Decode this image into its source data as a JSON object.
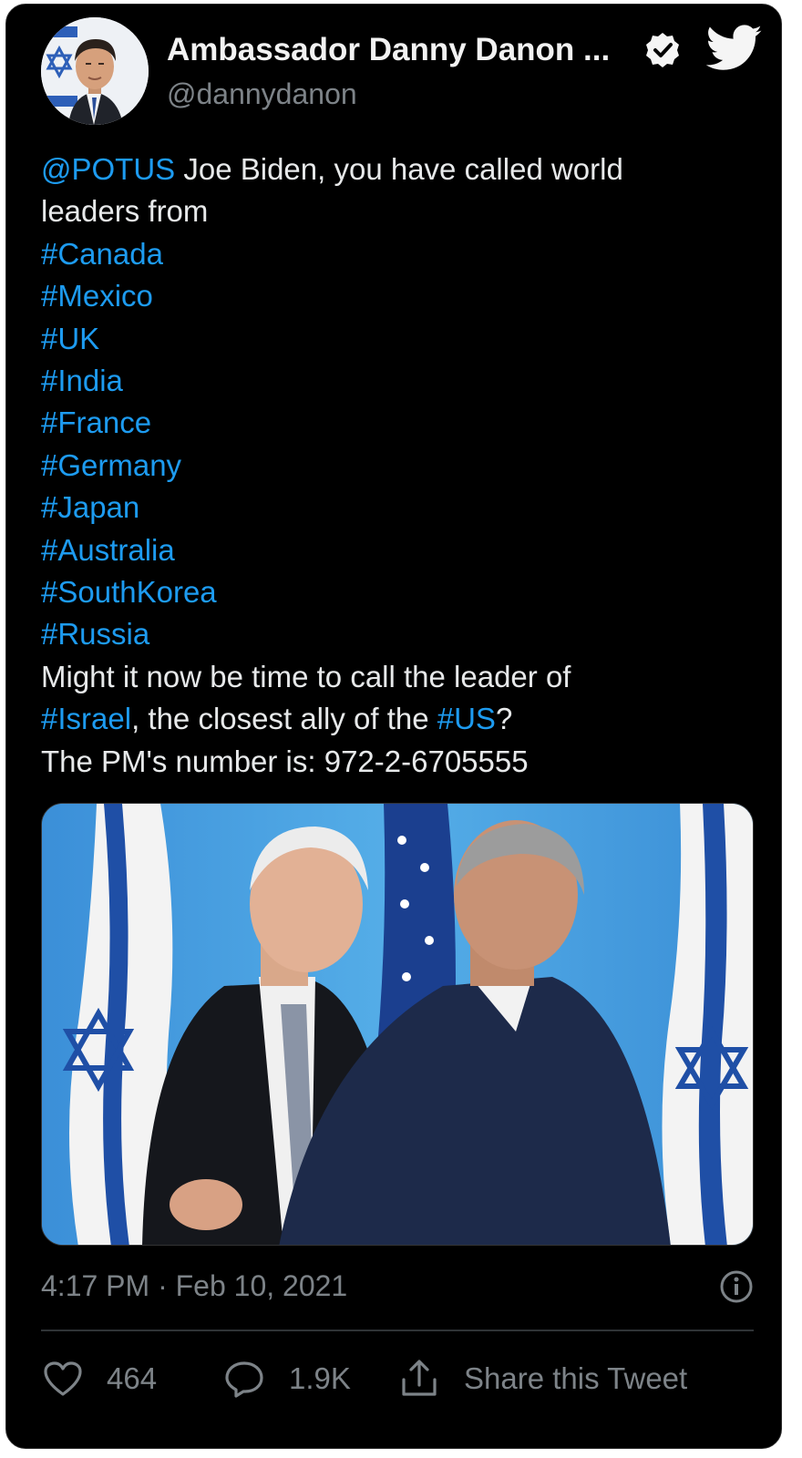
{
  "author": {
    "display_name": "Ambassador Danny Danon ...",
    "handle": "@dannydanon",
    "verified_icon": "verified-badge-icon",
    "platform_icon": "twitter-bird-icon"
  },
  "tweet": {
    "mention": "@POTUS",
    "intro_rest": " Joe Biden, you have called world",
    "intro_line2": "leaders from",
    "hashtags": [
      "#Canada",
      "#Mexico",
      "#UK",
      "#India",
      "#France",
      "#Germany",
      "#Japan",
      "#Australia",
      "#SouthKorea",
      "#Russia"
    ],
    "closing_line1": "Might it now be time to call the leader of",
    "israel_tag": "#Israel",
    "closing_mid": ", the closest ally of the ",
    "us_tag": "#US",
    "closing_end": "?",
    "phone_line": "The PM's number is: 972-2-6705555"
  },
  "meta": {
    "timestamp": "4:17 PM · Feb 10, 2021"
  },
  "actions": {
    "likes": "464",
    "replies": "1.9K",
    "share_label": "Share this Tweet"
  },
  "colors": {
    "background": "#000000",
    "text": "#e7e9ea",
    "link": "#1d9bf0",
    "muted": "#7d8388"
  }
}
